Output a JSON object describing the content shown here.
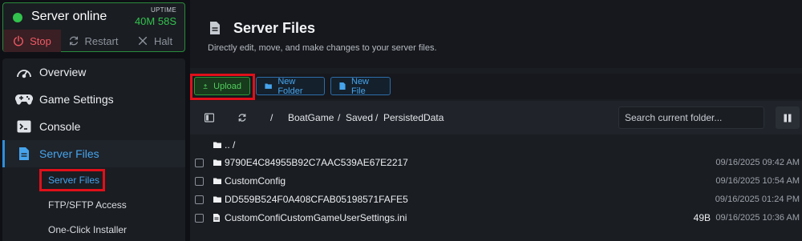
{
  "status": {
    "text": "Server online",
    "uptime_label": "UPTIME",
    "uptime_value": "40M 58S",
    "colors": {
      "online": "#32c24d",
      "stop": "#ef5a64",
      "accent": "#46a4ec",
      "highlight": "#e0101a"
    }
  },
  "power": {
    "stop": "Stop",
    "restart": "Restart",
    "halt": "Halt"
  },
  "nav": {
    "overview": "Overview",
    "game_settings": "Game Settings",
    "console": "Console",
    "server_files": "Server Files",
    "sub": {
      "server_files": "Server Files",
      "ftp": "FTP/SFTP Access",
      "installer": "One-Click Installer"
    }
  },
  "header": {
    "title": "Server Files",
    "subtitle": "Directly edit, move, and make changes to your server files."
  },
  "toolbar": {
    "upload": "Upload",
    "new_folder": "New Folder",
    "new_file": "New File"
  },
  "path": {
    "root": "/",
    "segments": [
      "BoatGame",
      "/",
      "Saved",
      "/",
      "PersistedData"
    ],
    "search_placeholder": "Search current folder..."
  },
  "files": [
    {
      "name": ".. /",
      "type": "folder",
      "size": "",
      "date": ""
    },
    {
      "name": "9790E4C84955B92C7AAC539AE67E2217",
      "type": "folder",
      "size": "",
      "date": "09/16/2025 09:42 AM"
    },
    {
      "name": "CustomConfig",
      "type": "folder",
      "size": "",
      "date": "09/16/2025 10:54 AM"
    },
    {
      "name": "DD559B524F0A408CFAB05198571FAFE5",
      "type": "folder",
      "size": "",
      "date": "09/16/2025 01:24 PM"
    },
    {
      "name": "CustomConfiCustomGameUserSettings.ini",
      "type": "file",
      "size": "49B",
      "date": "09/16/2025 10:36 AM"
    }
  ]
}
